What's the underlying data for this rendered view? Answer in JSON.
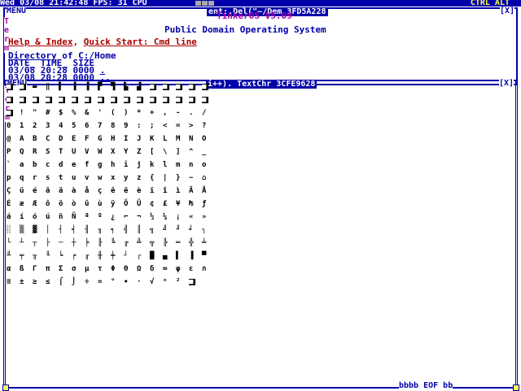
{
  "topbar": {
    "clock": "Wed 03/08 21:42:48 FPS: 31 CPU",
    "keys": "CTRL ALT"
  },
  "win1": {
    "menu": "MENU",
    "title": "ent;.Del(\"~/Dem 3FD5A228",
    "close": "[X]",
    "side": [
      "T",
      "e",
      "r",
      "m"
    ],
    "os_name": "TinkerOS V5.09",
    "tagline": "Public Domain Operating System",
    "links": {
      "help": "Help & Index",
      "sep": ",",
      "quick": "Quick Start: Cmd line"
    },
    "dir_label": "Directory",
    "dir_of": " of C:/Home",
    "cols": [
      "DATE_",
      "TIME_",
      "SIZE"
    ],
    "rows": [
      {
        "date": "03/08",
        "time": "20:28",
        "size": "0000",
        "name": "."
      },
      {
        "date": "03/08",
        "time": "20:28",
        "size": "0000",
        "name": ".."
      }
    ]
  },
  "win2": {
    "menu": "MENU",
    "title": "i++).  TextChr 3CFE9628",
    "close": "[X]",
    "side": [
      "T",
      "e",
      "r",
      "m"
    ],
    "charmap": [
      [
        "■",
        "■",
        "▬",
        "‖",
        "▌",
        "▐",
        "▐",
        "▛",
        "▜",
        "▙",
        "▟",
        "■",
        "■",
        "■",
        "■",
        "■"
      ],
      [
        "■",
        "■",
        "■",
        "■",
        "■",
        "■",
        "■",
        "■",
        "■",
        "■",
        "■",
        "■",
        "■",
        "■",
        "■",
        "■"
      ],
      [
        "■",
        "!",
        "\"",
        "#",
        "$",
        "%",
        "&",
        "'",
        "(",
        ")",
        "*",
        "+",
        ",",
        "-",
        ".",
        "/"
      ],
      [
        "0",
        "1",
        "2",
        "3",
        "4",
        "5",
        "6",
        "7",
        "8",
        "9",
        ":",
        ";",
        "<",
        "=",
        ">",
        "?"
      ],
      [
        "@",
        "A",
        "B",
        "C",
        "D",
        "E",
        "F",
        "G",
        "H",
        "I",
        "J",
        "K",
        "L",
        "M",
        "N",
        "O"
      ],
      [
        "P",
        "Q",
        "R",
        "S",
        "T",
        "U",
        "V",
        "W",
        "X",
        "Y",
        "Z",
        "[",
        "\\",
        "]",
        "^",
        "_"
      ],
      [
        "`",
        "a",
        "b",
        "c",
        "d",
        "e",
        "f",
        "g",
        "h",
        "i",
        "j",
        "k",
        "l",
        "m",
        "n",
        "o"
      ],
      [
        "p",
        "q",
        "r",
        "s",
        "t",
        "u",
        "v",
        "w",
        "x",
        "y",
        "z",
        "{",
        "|",
        "}",
        "~",
        "⌂"
      ],
      [
        "Ç",
        "ü",
        "é",
        "â",
        "ä",
        "à",
        "å",
        "ç",
        "ê",
        "ë",
        "è",
        "ï",
        "î",
        "ì",
        "Ä",
        "Å"
      ],
      [
        "É",
        "æ",
        "Æ",
        "ô",
        "ö",
        "ò",
        "û",
        "ù",
        "ÿ",
        "Ö",
        "Ü",
        "¢",
        "£",
        "¥",
        "₧",
        "ƒ"
      ],
      [
        "á",
        "í",
        "ó",
        "ú",
        "ñ",
        "Ñ",
        "ª",
        "º",
        "¿",
        "⌐",
        "¬",
        "½",
        "¼",
        "¡",
        "«",
        "»"
      ],
      [
        "░",
        "▒",
        "▓",
        "│",
        "┤",
        "╡",
        "╢",
        "╖",
        "╕",
        "╣",
        "║",
        "╗",
        "╝",
        "╜",
        "╛",
        "┐"
      ],
      [
        "└",
        "┴",
        "┬",
        "├",
        "─",
        "┼",
        "╞",
        "╟",
        "╚",
        "╔",
        "╩",
        "╦",
        "╠",
        "═",
        "╬",
        "╧"
      ],
      [
        "╨",
        "╤",
        "╥",
        "╙",
        "╘",
        "╒",
        "╓",
        "╫",
        "╪",
        "┘",
        "┌",
        "█",
        "▄",
        "▌",
        "▐",
        "▀"
      ],
      [
        "α",
        "ß",
        "Γ",
        "π",
        "Σ",
        "σ",
        "µ",
        "τ",
        "Φ",
        "Θ",
        "Ω",
        "δ",
        "∞",
        "φ",
        "ε",
        "∩"
      ],
      [
        "≡",
        "±",
        "≥",
        "≤",
        "⌠",
        "⌡",
        "÷",
        "≈",
        "°",
        "∙",
        "·",
        "√",
        "ⁿ",
        "²",
        "■",
        " "
      ]
    ],
    "bottom": "bbbb EOF    bb"
  }
}
